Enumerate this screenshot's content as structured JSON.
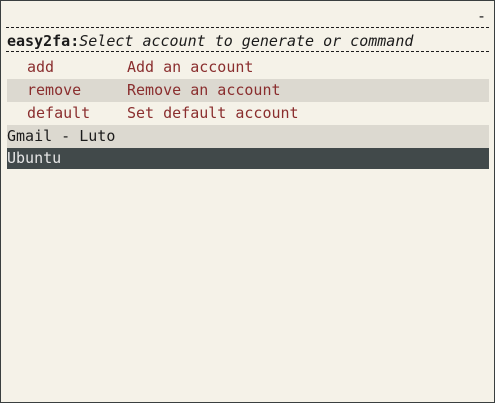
{
  "menu": {
    "corner_glyph": "-",
    "app_name": "easy2fa:",
    "prompt_text": "Select account to generate or command",
    "commands": [
      {
        "name": "add",
        "description": "Add an account"
      },
      {
        "name": "remove",
        "description": "Remove an account"
      },
      {
        "name": "default",
        "description": "Set default account"
      }
    ],
    "accounts": [
      {
        "label": "Gmail - Luto"
      },
      {
        "label": "Ubuntu",
        "selected": true
      }
    ]
  },
  "colors": {
    "background": "#f5f2e8",
    "command_text": "#8a2e2e",
    "alt_row": "#dcd9d0",
    "selected_row": "#41494a",
    "selected_text": "#e6e6e6"
  }
}
